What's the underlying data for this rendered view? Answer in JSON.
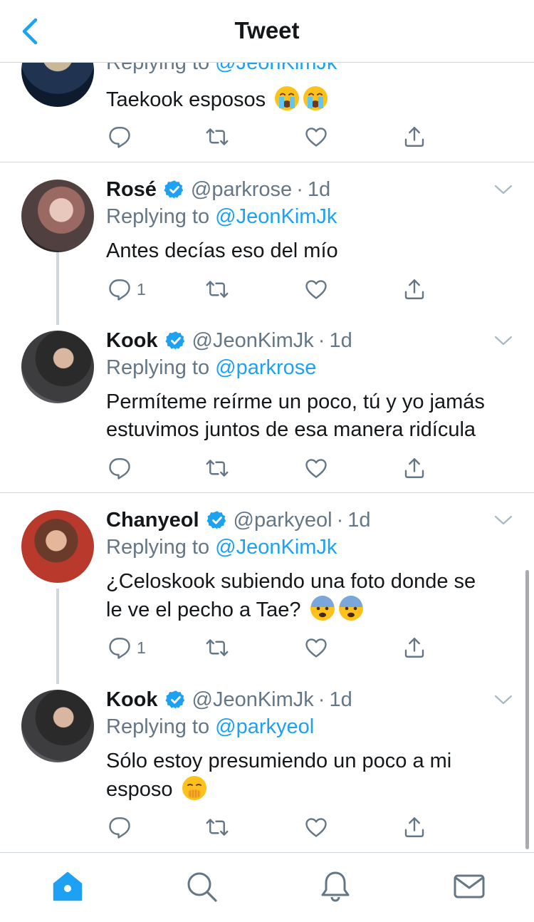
{
  "header": {
    "title": "Tweet"
  },
  "colors": {
    "link": "#1da1f2",
    "muted": "#657786",
    "text": "#14171a",
    "border": "#cfd6dc"
  },
  "partial_tweet": {
    "reply_prefix": "Replying to",
    "reply_to": "@JeonKimJk",
    "text": "Taekook esposos",
    "emojis": [
      "crying-face-emoji",
      "crying-face-emoji"
    ]
  },
  "tweets": [
    {
      "name": "Rosé",
      "handle": "@parkrose",
      "time": "1d",
      "reply_prefix": "Replying to",
      "reply_to": "@JeonKimJk",
      "text": "Antes decías eso del mío",
      "reply_count": "1"
    },
    {
      "name": "Kook",
      "handle": "@JeonKimJk",
      "time": "1d",
      "reply_prefix": "Replying to",
      "reply_to": "@parkrose",
      "text_line1": "Permíteme reírme un poco, tú y yo jamás",
      "text_line2": "estuvimos juntos de esa manera ridícula",
      "reply_count": ""
    },
    {
      "name": "Chanyeol",
      "handle": "@parkyeol",
      "time": "1d",
      "reply_prefix": "Replying to",
      "reply_to": "@JeonKimJk",
      "text_line1": "¿Celoskook subiendo una foto donde se",
      "text_line2": "le ve el pecho a Tae?",
      "emojis": [
        "fearful-face-emoji",
        "fearful-face-emoji"
      ],
      "reply_count": "1"
    },
    {
      "name": "Kook",
      "handle": "@JeonKimJk",
      "time": "1d",
      "reply_prefix": "Replying to",
      "reply_to": "@parkyeol",
      "text_line1": "Sólo estoy presumiendo un poco a mi",
      "text_line2": "esposo",
      "emojis": [
        "face-with-hand-over-mouth-emoji"
      ],
      "reply_count": ""
    }
  ],
  "tabbar": {
    "items": [
      "home-icon",
      "search-icon",
      "notifications-bell-icon",
      "messages-envelope-icon"
    ],
    "active": "home-icon"
  }
}
